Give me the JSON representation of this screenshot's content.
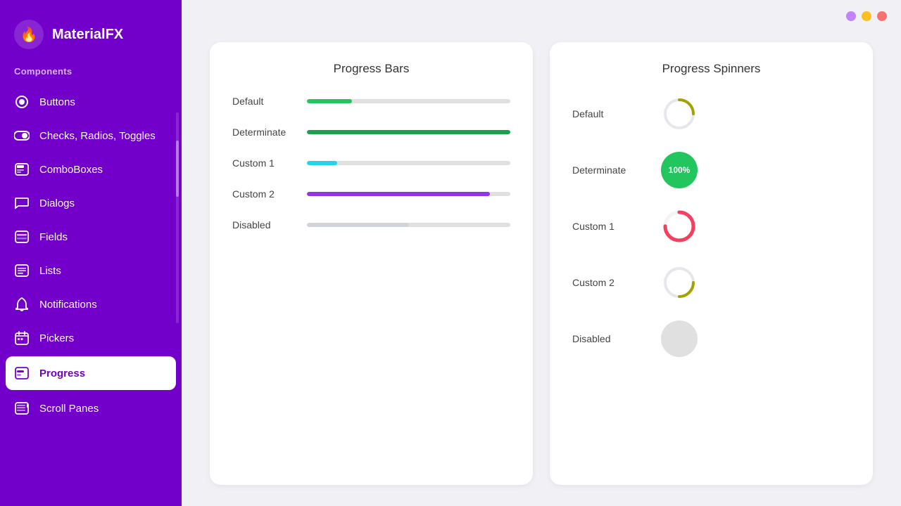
{
  "sidebar": {
    "logo_text": "MaterialFX",
    "logo_icon": "🔥",
    "section_title": "Components",
    "nav_items": [
      {
        "id": "buttons",
        "label": "Buttons",
        "icon": "radio_button"
      },
      {
        "id": "checks",
        "label": "Checks, Radios, Toggles",
        "icon": "toggle"
      },
      {
        "id": "comboboxes",
        "label": "ComboBoxes",
        "icon": "combobox"
      },
      {
        "id": "dialogs",
        "label": "Dialogs",
        "icon": "chat"
      },
      {
        "id": "fields",
        "label": "Fields",
        "icon": "fields"
      },
      {
        "id": "lists",
        "label": "Lists",
        "icon": "list"
      },
      {
        "id": "notifications",
        "label": "Notifications",
        "icon": "bell"
      },
      {
        "id": "pickers",
        "label": "Pickers",
        "icon": "pickers"
      },
      {
        "id": "progress",
        "label": "Progress",
        "icon": "progress",
        "active": true
      },
      {
        "id": "scroll-panes",
        "label": "Scroll Panes",
        "icon": "scroll"
      }
    ]
  },
  "top_dots": [
    {
      "color": "#c084fc"
    },
    {
      "color": "#fbbf24"
    },
    {
      "color": "#f87171"
    }
  ],
  "progress_bars": {
    "title": "Progress Bars",
    "rows": [
      {
        "label": "Default",
        "fill_pct": 22,
        "color": "#22c55e",
        "disabled": false
      },
      {
        "label": "Determinate",
        "fill_pct": 100,
        "color": "#16a34a",
        "disabled": false
      },
      {
        "label": "Custom 1",
        "fill_pct": 15,
        "color": "#22d3ee",
        "disabled": false
      },
      {
        "label": "Custom 2",
        "fill_pct": 90,
        "color": "#9333ea",
        "disabled": false
      },
      {
        "label": "Disabled",
        "fill_pct": 50,
        "color": "#d1d5db",
        "disabled": true
      }
    ]
  },
  "progress_spinners": {
    "title": "Progress Spinners",
    "rows": [
      {
        "label": "Default",
        "type": "arc",
        "color": "#a3a300",
        "bg": "none"
      },
      {
        "label": "Determinate",
        "type": "filled-circle",
        "color": "#22c55e",
        "text": "100%",
        "text_color": "white"
      },
      {
        "label": "Custom 1",
        "type": "arc",
        "color": "#f43f5e",
        "bg": "#f3f4f6"
      },
      {
        "label": "Custom 2",
        "type": "arc-small",
        "color": "#a3a300",
        "bg": "none"
      },
      {
        "label": "Disabled",
        "type": "disabled",
        "color": "#e5e7eb"
      }
    ]
  }
}
